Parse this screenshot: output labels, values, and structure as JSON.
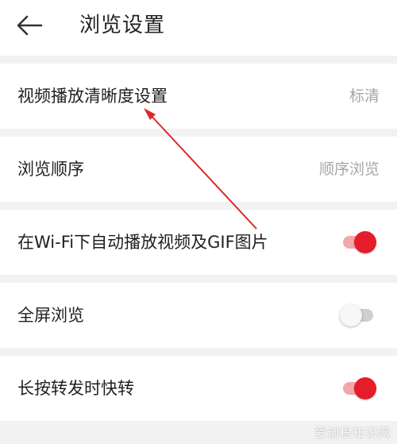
{
  "header": {
    "back_icon": "arrow-left-icon",
    "title": "浏览设置"
  },
  "settings": [
    {
      "label": "视频播放清晰度设置",
      "value": "标清"
    },
    {
      "label": "浏览顺序",
      "value": "顺序浏览"
    },
    {
      "label": "在Wi-Fi下自动播放视频及GIF图片",
      "toggle": true
    },
    {
      "label": "全屏浏览",
      "toggle": false
    },
    {
      "label": "长按转发时快转",
      "toggle": true
    }
  ],
  "colors": {
    "toggle_on": "#e51c2a",
    "annotation_arrow": "#d92a2a"
  },
  "watermark": "爱创根知识网"
}
